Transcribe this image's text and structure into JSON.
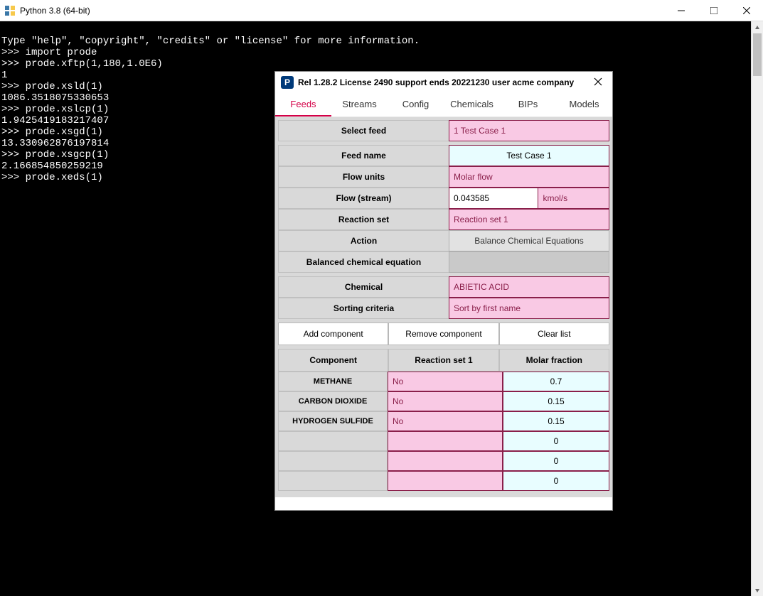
{
  "window": {
    "title": "Python 3.8 (64-bit)"
  },
  "console": {
    "lines": [
      "Type \"help\", \"copyright\", \"credits\" or \"license\" for more information.",
      ">>> import prode",
      ">>> prode.xftp(1,180,1.0E6)",
      "1",
      ">>> prode.xsld(1)",
      "1086.3518075330653",
      ">>> prode.xslcp(1)",
      "1.9425419183217407",
      ">>> prode.xsgd(1)",
      "13.330962876197814",
      ">>> prode.xsgcp(1)",
      "2.166854850259219",
      ">>> prode.xeds(1)"
    ]
  },
  "dialog": {
    "title": "Rel 1.28.2 License 2490 support ends 20221230 user acme company",
    "tabs": [
      "Feeds",
      "Streams",
      "Config",
      "Chemicals",
      "BIPs",
      "Models"
    ],
    "activeTab": 0,
    "selectFeed": {
      "label": "Select feed",
      "value": "1  Test Case 1"
    },
    "feedName": {
      "label": "Feed name",
      "value": "Test Case 1"
    },
    "flowUnits": {
      "label": "Flow units",
      "value": "Molar flow"
    },
    "flowStream": {
      "label": "Flow (stream)",
      "value": "0.043585",
      "unit": "kmol/s"
    },
    "reactionSet": {
      "label": "Reaction set",
      "value": "Reaction set 1"
    },
    "action": {
      "label": "Action",
      "button": "Balance Chemical Equations"
    },
    "balanced": {
      "label": "Balanced chemical equation"
    },
    "chemical": {
      "label": "Chemical",
      "value": "ABIETIC ACID"
    },
    "sorting": {
      "label": "Sorting criteria",
      "value": "Sort by first name"
    },
    "buttons": {
      "add": "Add component",
      "remove": "Remove component",
      "clear": "Clear list"
    },
    "table": {
      "headers": [
        "Component",
        "Reaction set 1",
        "Molar fraction"
      ],
      "rows": [
        {
          "name": "METHANE",
          "rs": "No",
          "mf": "0.7"
        },
        {
          "name": "CARBON DIOXIDE",
          "rs": "No",
          "mf": "0.15"
        },
        {
          "name": "HYDROGEN SULFIDE",
          "rs": "No",
          "mf": "0.15"
        },
        {
          "name": "",
          "rs": "",
          "mf": "0"
        },
        {
          "name": "",
          "rs": "",
          "mf": "0"
        },
        {
          "name": "",
          "rs": "",
          "mf": "0"
        }
      ]
    }
  }
}
